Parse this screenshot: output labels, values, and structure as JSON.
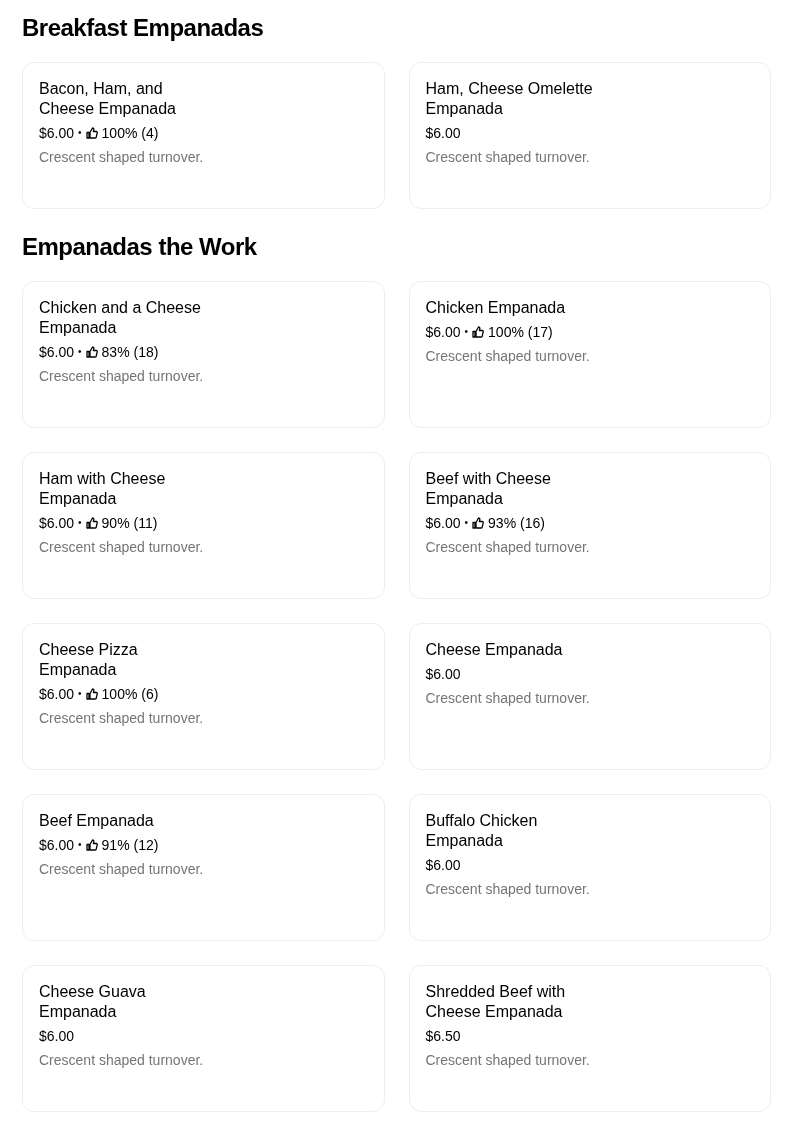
{
  "sections": [
    {
      "title": "Breakfast Empanadas",
      "items": [
        {
          "name": "Bacon, Ham, and Cheese Empanada",
          "price": "$6.00",
          "separator": "•",
          "rating": "100% (4)",
          "description": "Crescent shaped turnover."
        },
        {
          "name": "Ham, Cheese Omelette Empanada",
          "price": "$6.00",
          "description": "Crescent shaped turnover."
        }
      ]
    },
    {
      "title": "Empanadas the Work",
      "items": [
        {
          "name": "Chicken and a Cheese Empanada",
          "price": "$6.00",
          "separator": "•",
          "rating": "83% (18)",
          "description": "Crescent shaped turnover."
        },
        {
          "name": "Chicken Empanada",
          "price": "$6.00",
          "separator": "•",
          "rating": "100% (17)",
          "description": "Crescent shaped turnover."
        },
        {
          "name": "Ham with Cheese Empanada",
          "price": "$6.00",
          "separator": "•",
          "rating": "90% (11)",
          "description": "Crescent shaped turnover."
        },
        {
          "name": "Beef with Cheese Empanada",
          "price": "$6.00",
          "separator": "•",
          "rating": "93% (16)",
          "description": "Crescent shaped turnover."
        },
        {
          "name": "Cheese Pizza Empanada",
          "price": "$6.00",
          "separator": "•",
          "rating": "100% (6)",
          "description": "Crescent shaped turnover."
        },
        {
          "name": "Cheese Empanada",
          "price": "$6.00",
          "description": "Crescent shaped turnover."
        },
        {
          "name": "Beef Empanada",
          "price": "$6.00",
          "separator": "•",
          "rating": "91% (12)",
          "description": "Crescent shaped turnover."
        },
        {
          "name": "Buffalo Chicken Empanada",
          "price": "$6.00",
          "description": "Crescent shaped turnover."
        },
        {
          "name": "Cheese Guava Empanada",
          "price": "$6.00",
          "description": "Crescent shaped turnover."
        },
        {
          "name": "Shredded Beef with Cheese Empanada",
          "price": "$6.50",
          "description": "Crescent shaped turnover."
        }
      ]
    }
  ]
}
